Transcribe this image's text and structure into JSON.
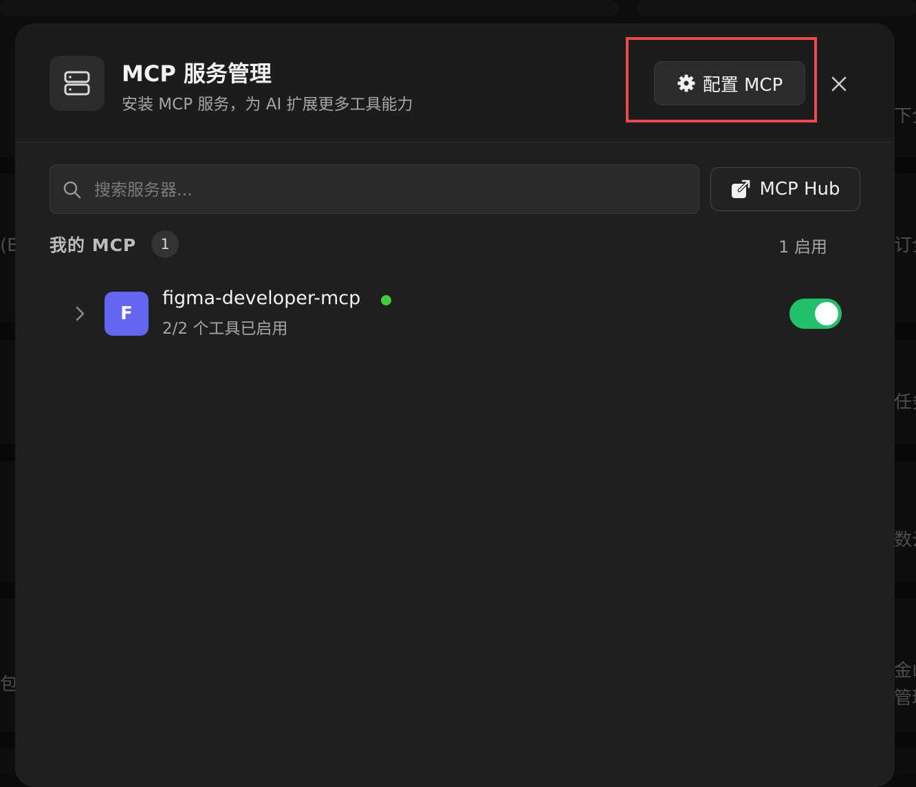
{
  "background": {
    "peek_texts": [
      "下全",
      "(B",
      "订全",
      "任务",
      "数云",
      "包",
      "金山",
      "管理"
    ]
  },
  "header": {
    "title": "MCP 服务管理",
    "subtitle": "安装 MCP 服务，为 AI 扩展更多工具能力",
    "icon": "server-stack-icon",
    "config_button_label": "配置 MCP",
    "config_button_icon": "gear-icon",
    "close_icon": "close-icon"
  },
  "search": {
    "placeholder": "搜索服务器...",
    "value": ""
  },
  "hub_button": {
    "label": "MCP Hub",
    "icon": "external-link-icon"
  },
  "section": {
    "title": "我的 MCP",
    "count": "1",
    "enabled_summary": "1 启用"
  },
  "servers": [
    {
      "avatar_letter": "F",
      "avatar_color": "#6366f1",
      "name": "figma-developer-mcp",
      "status_color": "#3fcf3a",
      "tools_summary": "2/2 个工具已启用",
      "enabled": true
    }
  ],
  "colors": {
    "modal_bg": "#1f1f1f",
    "highlight": "#f0494e",
    "toggle_on": "#22c06a"
  }
}
